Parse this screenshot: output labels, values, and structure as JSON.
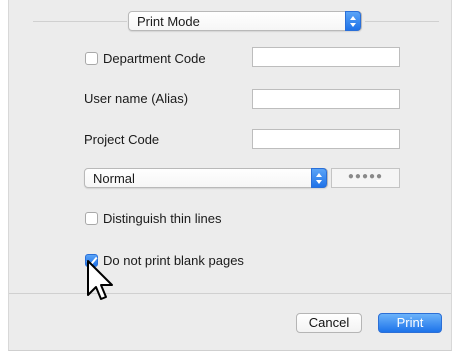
{
  "mode_popup": {
    "value": "Print Mode"
  },
  "department": {
    "label": "Department Code",
    "checked": false,
    "value": ""
  },
  "user_name": {
    "label": "User name (Alias)",
    "value": ""
  },
  "project": {
    "label": "Project Code",
    "value": ""
  },
  "print_type_popup": {
    "value": "Normal"
  },
  "password_field": {
    "mask": "●●●●●"
  },
  "distinguish_thin_lines": {
    "label": "Distinguish thin lines",
    "checked": false
  },
  "do_not_print_blank": {
    "label": "Do not print blank pages",
    "checked": true
  },
  "buttons": {
    "cancel": "Cancel",
    "print": "Print"
  },
  "colors": {
    "accent": "#1f72e8",
    "panel_bg": "#ececec"
  },
  "icons": {
    "cursor": "arrow-pointer-icon",
    "popup": "popup-stepper-icon",
    "check": "checkmark-icon"
  }
}
